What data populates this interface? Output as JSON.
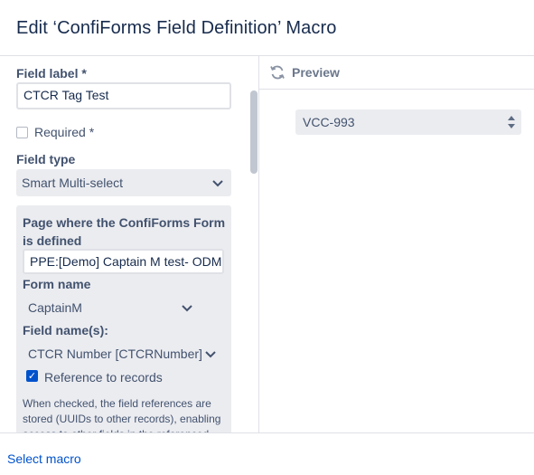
{
  "dialog": {
    "title": "Edit ‘ConfiForms Field Definition’ Macro"
  },
  "form": {
    "field_label": {
      "label": "Field label *",
      "value": "CTCR Tag Test"
    },
    "required": {
      "label": "Required *",
      "checked": false
    },
    "field_type": {
      "label": "Field type",
      "value": "Smart Multi-select"
    },
    "source": {
      "page_label": "Page where the ConfiForms Form is defined",
      "page_value": "PPE:[Demo] Captain M test- ODM",
      "form_name_label": "Form name",
      "form_name_value": "CaptainM",
      "field_names_label": "Field name(s):",
      "field_names_value": "CTCR Number [CTCRNumber]",
      "reference_label": "Reference to records",
      "reference_checked": true,
      "help_text": "When checked, the field references are stored (UUIDs to other records), enabling access to other fields in the referenced"
    }
  },
  "preview": {
    "title": "Preview",
    "field_value": "VCC-993"
  },
  "footer": {
    "select_macro": "Select macro"
  },
  "icons": {
    "refresh": "refresh-icon",
    "chevron": "chevron-down-icon",
    "checkmark": "checkmark-icon",
    "spinner": "spinner-arrows-icon"
  },
  "colors": {
    "link": "#0052cc",
    "checkbox_checked": "#0052cc",
    "field_bg": "#ebecf0",
    "border": "#dfe1e6"
  }
}
